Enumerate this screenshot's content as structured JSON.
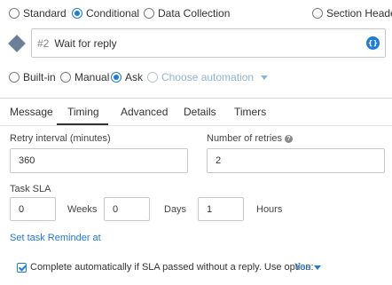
{
  "task_type": {
    "options": [
      "Standard",
      "Conditional",
      "Data Collection",
      "Section Header"
    ],
    "selected": "Conditional"
  },
  "step": {
    "number": "#2",
    "name": "Wait for reply",
    "bracket_icon": "{}"
  },
  "automation": {
    "options": [
      "Built-in",
      "Manual",
      "Ask"
    ],
    "selected": "Ask",
    "choose_label": "Choose automation"
  },
  "tabs": [
    "Message",
    "Timing",
    "Advanced",
    "Details",
    "Timers"
  ],
  "active_tab": "Timing",
  "timing": {
    "retry_interval_label": "Retry interval (minutes)",
    "retry_interval_value": "360",
    "retries_label": "Number of retries",
    "retries_value": "2",
    "sla_label": "Task SLA",
    "sla_weeks": "0",
    "weeks_label": "Weeks",
    "sla_days": "0",
    "days_label": "Days",
    "sla_hours": "1",
    "hours_label": "Hours",
    "reminder_link": "Set task Reminder at",
    "auto_complete_text": "Complete automatically if SLA passed without a reply. Use option:",
    "auto_complete_option": "Yes"
  },
  "colors": {
    "accent": "#1e7bd6",
    "diamond": "#6b7f99"
  }
}
